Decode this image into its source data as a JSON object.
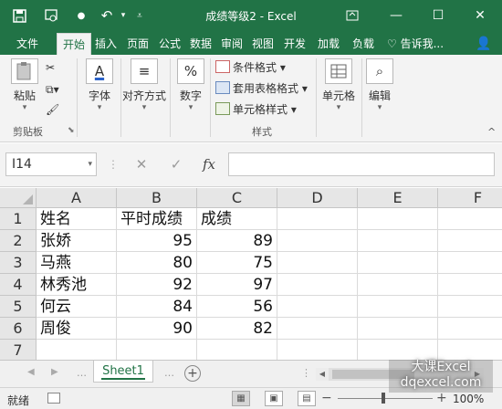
{
  "titlebar": {
    "document_title": "成绩等级2 - Excel",
    "save_icon": "save-icon",
    "touch_icon": "touch-mode-icon",
    "undo_icon": "undo-icon",
    "customize_icon": "customize-qat-icon",
    "colors": {
      "brand": "#217346"
    }
  },
  "tabs": [
    "文件",
    "开始",
    "插入",
    "页面",
    "公式",
    "数据",
    "审阅",
    "视图",
    "开发",
    "加载",
    "负载"
  ],
  "active_tab": "开始",
  "tellme": "告诉我...",
  "ribbon": {
    "clipboard": {
      "paste": "粘贴",
      "group": "剪贴板"
    },
    "font": {
      "label": "字体"
    },
    "alignment": {
      "label": "对齐方式"
    },
    "number": {
      "label": "数字",
      "icon_text": "%"
    },
    "styles": {
      "conditional": "条件格式",
      "table": "套用表格格式",
      "cell_styles": "单元格样式",
      "group": "样式"
    },
    "cells": {
      "label": "单元格"
    },
    "editing": {
      "label": "编辑"
    }
  },
  "formula_bar": {
    "name_box": "I14",
    "fx": "fx",
    "value": ""
  },
  "sheet": {
    "columns": [
      "A",
      "B",
      "C",
      "D",
      "E",
      "F"
    ],
    "rows": [
      "1",
      "2",
      "3",
      "4",
      "5",
      "6",
      "7"
    ],
    "cells": [
      [
        "姓名",
        "平时成绩",
        "成绩"
      ],
      [
        "张娇",
        "95",
        "89"
      ],
      [
        "马燕",
        "80",
        "75"
      ],
      [
        "林秀池",
        "92",
        "97"
      ],
      [
        "何云",
        "84",
        "56"
      ],
      [
        "周俊",
        "90",
        "82"
      ],
      [
        "",
        "",
        ""
      ]
    ]
  },
  "sheet_tabs": {
    "active": "Sheet1"
  },
  "status": {
    "ready": "就绪",
    "zoom": "100%"
  },
  "watermark": {
    "line1": "大课Excel",
    "line2": "dqexcel.com"
  }
}
